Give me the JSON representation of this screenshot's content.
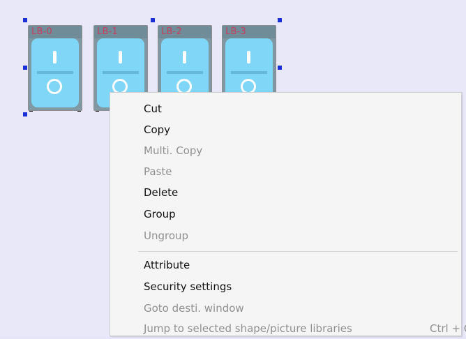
{
  "canvas": {
    "background_color": "#e8e8f9"
  },
  "switches": [
    {
      "label": "LB-0"
    },
    {
      "label": "LB-1"
    },
    {
      "label": "LB-2"
    },
    {
      "label": "LB-3"
    }
  ],
  "context_menu": {
    "items": [
      {
        "label": "Cut",
        "enabled": true
      },
      {
        "label": "Copy",
        "enabled": true
      },
      {
        "label": "Multi. Copy",
        "enabled": false
      },
      {
        "label": "Paste",
        "enabled": false
      },
      {
        "label": "Delete",
        "enabled": true
      },
      {
        "label": "Group",
        "enabled": true
      },
      {
        "label": "Ungroup",
        "enabled": false
      },
      {
        "label": "Attribute",
        "enabled": true
      },
      {
        "label": "Security settings",
        "enabled": true
      },
      {
        "label": "Goto desti. window",
        "enabled": false
      },
      {
        "label": "Jump to selected shape/picture libraries",
        "enabled": false,
        "shortcut": "Ctrl + G"
      }
    ]
  },
  "colors": {
    "selection_handle": "#1b2fd6",
    "switch_body": "#7fd6f6",
    "label_text": "#c44060"
  }
}
